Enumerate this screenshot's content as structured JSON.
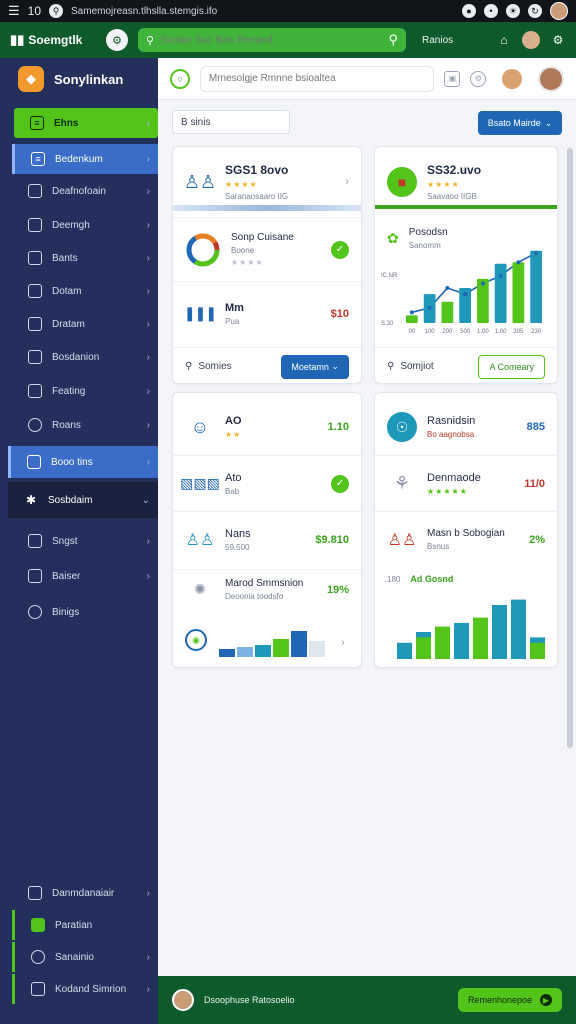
{
  "statusbar": {
    "time": "10",
    "url": "Samemojreasn.tlhslla.stemgis.ifo"
  },
  "topbar": {
    "brand": "Soemgtlk",
    "search_placeholder": "Sootan Soo Bow Renand",
    "link": "Ranios"
  },
  "sidebar": {
    "brand": "Sonylinkan",
    "items": [
      {
        "label": "Ehns",
        "icon": "grid-icon"
      },
      {
        "label": "Bedenkum",
        "icon": "dashboard-icon"
      },
      {
        "label": "Deafnofoain",
        "icon": "monitor-icon"
      },
      {
        "label": "Deemgh",
        "icon": "layers-icon"
      },
      {
        "label": "Bants",
        "icon": "list-icon"
      },
      {
        "label": "Dotam",
        "icon": "folder-icon"
      },
      {
        "label": "Dratam",
        "icon": "calendar-icon"
      },
      {
        "label": "Bosdanion",
        "icon": "chart-icon"
      },
      {
        "label": "Feating",
        "icon": "card-icon"
      },
      {
        "label": "Roans",
        "icon": "clock-icon"
      },
      {
        "label": "Booo tins",
        "icon": "image-icon"
      },
      {
        "label": "Sosbdaim",
        "icon": "settings-icon"
      },
      {
        "label": "Sngst",
        "icon": "file-icon"
      },
      {
        "label": "Baiser",
        "icon": "box-icon"
      },
      {
        "label": "Binigs",
        "icon": "info-icon"
      }
    ],
    "bottom_items": [
      {
        "label": "Danmdanaiair",
        "icon": "notes-icon"
      },
      {
        "label": "Paratian",
        "icon": "doc-icon"
      },
      {
        "label": "Sanainio",
        "icon": "user-icon"
      },
      {
        "label": "Kodand Simrion",
        "icon": "tool-icon"
      }
    ]
  },
  "mainhead": {
    "search_placeholder": "Mrnesolgje Rmnne bsioaltea"
  },
  "filter": {
    "input_value": "B sinis",
    "button_label": "Bsato Mairde"
  },
  "left_card_top": {
    "stat_title": "SGS1 8ovo",
    "stat_sub": "Saranaosaaro IIG",
    "item2_title": "Sonp Cuisane",
    "item2_sub": "Boone",
    "item3_title": "Mm",
    "item3_sub": "Pua",
    "item3_value": "$10",
    "search_text": "Somies",
    "button_label": "Moetamn"
  },
  "right_card_top": {
    "stat_title": "SS32.uvo",
    "stat_sub": "Saavaoo IIGB",
    "chart_title": "Posodsn",
    "chart_sub": "Sanomm",
    "search_text": "Somjiot",
    "button_label": "A Comeary"
  },
  "left_card_bottom": {
    "row1_title": "AO",
    "row1_value": "1.10",
    "row2_title": "Ato",
    "row2_sub": "Bab",
    "row3_title": "Nans",
    "row3_sub": "59.500",
    "row3_value": "$9.810",
    "row4_title": "Marod Smmsnion",
    "row4_sub": "Deoonia toodsfo",
    "row4_value": "19%"
  },
  "right_card_bottom": {
    "row1_title": "Rasnidsin",
    "row1_sub": "Bo aagnobsa",
    "row1_value": "885",
    "row2_title": "Denmaode",
    "row2_value": "11/0",
    "row3_title": "Masn b Sobogian",
    "row3_sub": "Bsnus",
    "row3_value": "2%",
    "chart_label": "180",
    "chart_title": "Ad Gosnd"
  },
  "footer": {
    "text": "Dsoophuse Ratosoelio",
    "button_label": "Remenhonepoe"
  },
  "colors": {
    "brand_green": "#52c41a",
    "dark_green": "#0f5a2a",
    "navy": "#24305c",
    "blue": "#1f66b5",
    "teal": "#1f97b8"
  },
  "chart_data": [
    {
      "type": "bar",
      "categories": [
        "00",
        "100",
        "200",
        "500",
        "1.00",
        "1.00",
        "305",
        "230"
      ],
      "series": [
        {
          "values": [
            10,
            38,
            28,
            46,
            58,
            78,
            80,
            95
          ]
        }
      ],
      "extra_line": [
        14,
        20,
        46,
        38,
        52,
        62,
        80,
        92
      ],
      "tick_labels_y": [
        "IC.NR",
        "S.30"
      ],
      "ylim": [
        0,
        100
      ]
    },
    {
      "type": "bar",
      "categories": [
        "a",
        "b",
        "c",
        "d",
        "e",
        "f",
        "g",
        "h"
      ],
      "series": [
        {
          "name": "teal",
          "values": [
            18,
            30,
            0,
            40,
            0,
            60,
            66,
            24
          ]
        },
        {
          "name": "green",
          "values": [
            0,
            24,
            36,
            0,
            46,
            0,
            0,
            18
          ]
        }
      ],
      "ylim": [
        0,
        80
      ]
    }
  ]
}
